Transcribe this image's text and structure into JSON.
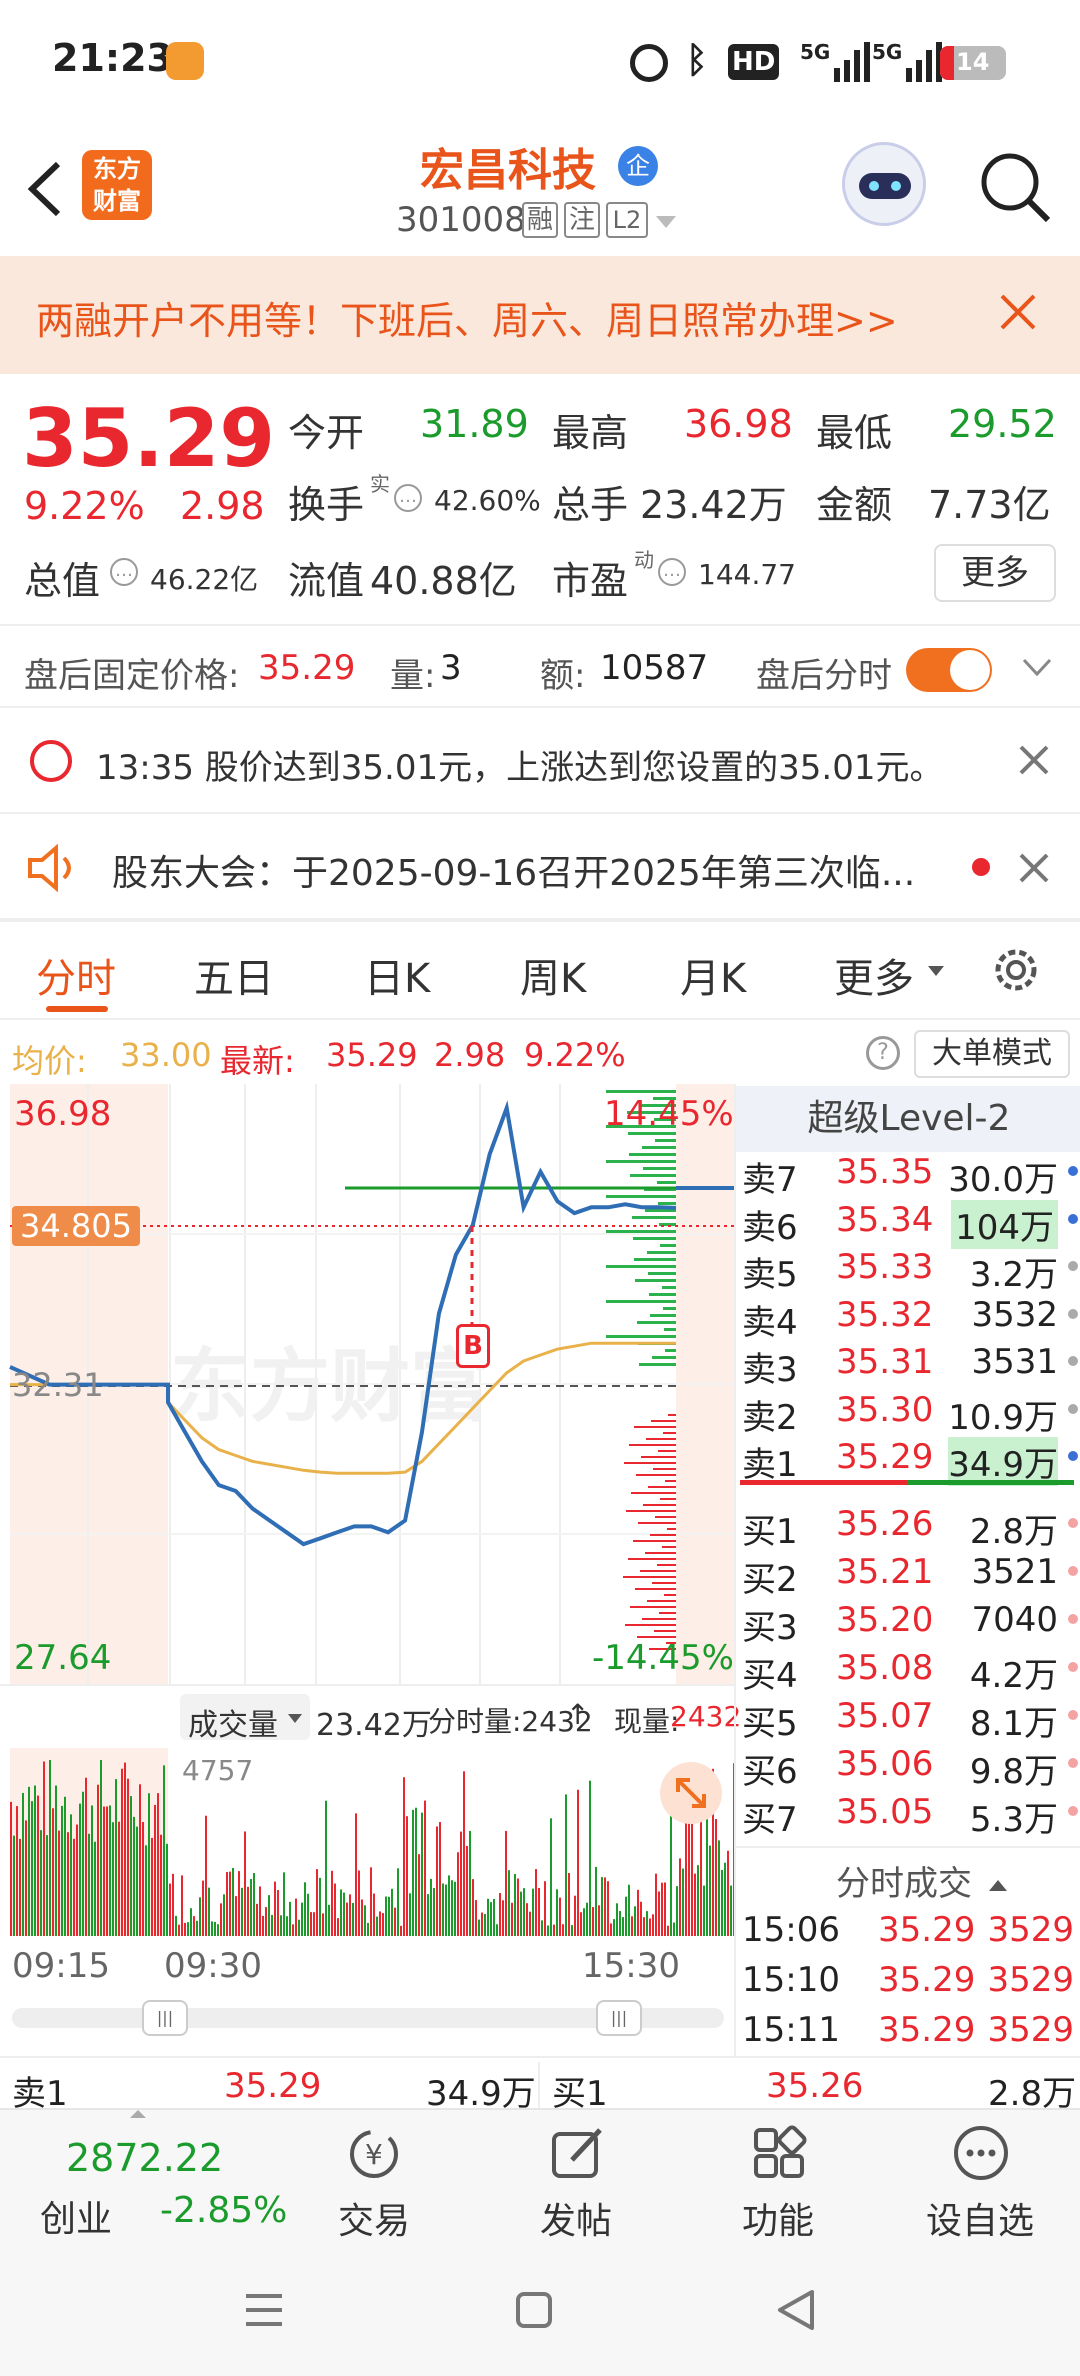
{
  "status_bar": {
    "time": "21:23",
    "battery": "14",
    "network_1": "5G",
    "network_2": "5G",
    "hd": "HD"
  },
  "header": {
    "back": "back",
    "logo_line1": "东方",
    "logo_line2": "财富",
    "stock_name": "宏昌科技",
    "name_badge": "企",
    "stock_code": "301008",
    "tags": [
      "融",
      "注",
      "L2"
    ]
  },
  "banner": {
    "text": "两融开户不用等！下班后、周六、周日照常办理>>"
  },
  "quote": {
    "price": "35.29",
    "change_pct": "9.22%",
    "change": "2.98",
    "open_label": "今开",
    "open": "31.89",
    "high_label": "最高",
    "high": "36.98",
    "low_label": "最低",
    "low": "29.52",
    "turnover_label": "换手",
    "turnover_sup": "实",
    "turnover": "42.60%",
    "volume_label": "总手",
    "volume": "23.42万",
    "amount_label": "金额",
    "amount": "7.73亿",
    "mcap_label": "总值",
    "mcap": "46.22亿",
    "float_label": "流值",
    "float": "40.88亿",
    "pe_label": "市盈",
    "pe_sup": "动",
    "pe": "144.77",
    "more": "更多"
  },
  "after_hours": {
    "price_label": "盘后固定价格:",
    "price": "35.29",
    "qty_label": "量:",
    "qty": "3",
    "amt_label": "额:",
    "amt": "10587",
    "toggle_label": "盘后分时"
  },
  "alert": {
    "text": "13:35 股价达到35.01元，上涨达到您设置的35.01元。"
  },
  "notice": {
    "text": "股东大会：于2025-09-16召开2025年第三次临..."
  },
  "tabs": [
    "分时",
    "五日",
    "日K",
    "周K",
    "月K",
    "更多"
  ],
  "chart_header": {
    "avg_label": "均价:",
    "avg": "33.00",
    "latest_label": "最新:",
    "latest": "35.29",
    "chg": "2.98",
    "chg_pct": "9.22%",
    "mode": "大单模式"
  },
  "chart_labels": {
    "top_left": "36.98",
    "top_right": "14.45%",
    "bottom_left": "27.64",
    "bottom_right": "-14.45%",
    "ref": "32.31",
    "cursor": "34.805",
    "marker": "B",
    "watermark": "东方财富"
  },
  "volume_header": {
    "selector": "成交量",
    "total": "23.42万",
    "tick_label": "分时量:2432",
    "now_label": "现量:",
    "now": "2432",
    "max": "4757"
  },
  "time_axis": [
    "09:15",
    "09:30",
    "15:30"
  ],
  "order_book": {
    "title": "超级Level-2",
    "asks": [
      {
        "label": "卖7",
        "price": "35.35",
        "vol": "30.0万"
      },
      {
        "label": "卖6",
        "price": "35.34",
        "vol": "104万"
      },
      {
        "label": "卖5",
        "price": "35.33",
        "vol": "3.2万"
      },
      {
        "label": "卖4",
        "price": "35.32",
        "vol": "3532"
      },
      {
        "label": "卖3",
        "price": "35.31",
        "vol": "3531"
      },
      {
        "label": "卖2",
        "price": "35.30",
        "vol": "10.9万"
      },
      {
        "label": "卖1",
        "price": "35.29",
        "vol": "34.9万"
      }
    ],
    "bids": [
      {
        "label": "买1",
        "price": "35.26",
        "vol": "2.8万"
      },
      {
        "label": "买2",
        "price": "35.21",
        "vol": "3521"
      },
      {
        "label": "买3",
        "price": "35.20",
        "vol": "7040"
      },
      {
        "label": "买4",
        "price": "35.08",
        "vol": "4.2万"
      },
      {
        "label": "买5",
        "price": "35.07",
        "vol": "8.1万"
      },
      {
        "label": "买6",
        "price": "35.06",
        "vol": "9.8万"
      },
      {
        "label": "买7",
        "price": "35.05",
        "vol": "5.3万"
      }
    ],
    "ticks_title": "分时成交",
    "ticks": [
      {
        "time": "15:06",
        "price": "35.29",
        "vol": "3529"
      },
      {
        "time": "15:10",
        "price": "35.29",
        "vol": "3529"
      },
      {
        "time": "15:11",
        "price": "35.29",
        "vol": "3529"
      }
    ]
  },
  "summary_row": {
    "ask_label": "卖1",
    "ask_price": "35.29",
    "ask_vol": "34.9万",
    "bid_label": "买1",
    "bid_price": "35.26",
    "bid_vol": "2.8万"
  },
  "bottom_nav": {
    "index_value": "2872.22",
    "index_name": "创业",
    "index_chg": "-2.85%",
    "items": [
      "交易",
      "发帖",
      "功能",
      "设自选"
    ]
  },
  "colors": {
    "red": "#e8272f",
    "green": "#1a9b2c",
    "orange": "#f07020",
    "price_line": "#2f6db5",
    "avg_line": "#e8b14a"
  },
  "chart_data": {
    "type": "line",
    "title": "",
    "ylim": [
      27.64,
      36.98
    ],
    "series": [
      {
        "values": [
          32.6,
          32.3,
          32.3,
          32.3,
          32.3,
          32.0,
          31.5,
          31.0,
          30.6,
          30.5,
          30.2,
          30.0,
          29.8,
          29.6,
          29.7,
          29.8,
          29.9,
          29.9,
          29.8,
          30.0,
          31.5,
          33.5,
          34.5,
          35.0,
          36.2,
          36.98,
          35.3,
          35.9,
          35.4,
          35.2,
          35.3,
          35.3,
          35.35,
          35.3,
          35.3,
          35.29
        ]
      },
      {
        "values": [
          32.3,
          32.3,
          32.3,
          32.3,
          32.3,
          32.0,
          31.7,
          31.4,
          31.2,
          31.1,
          31.0,
          30.95,
          30.9,
          30.85,
          30.82,
          30.8,
          30.8,
          30.8,
          30.8,
          30.82,
          31.0,
          31.3,
          31.6,
          31.9,
          32.2,
          32.5,
          32.7,
          32.8,
          32.9,
          32.95,
          33.0,
          33.0,
          33.0,
          33.0,
          33.0,
          33.0
        ]
      }
    ]
  }
}
